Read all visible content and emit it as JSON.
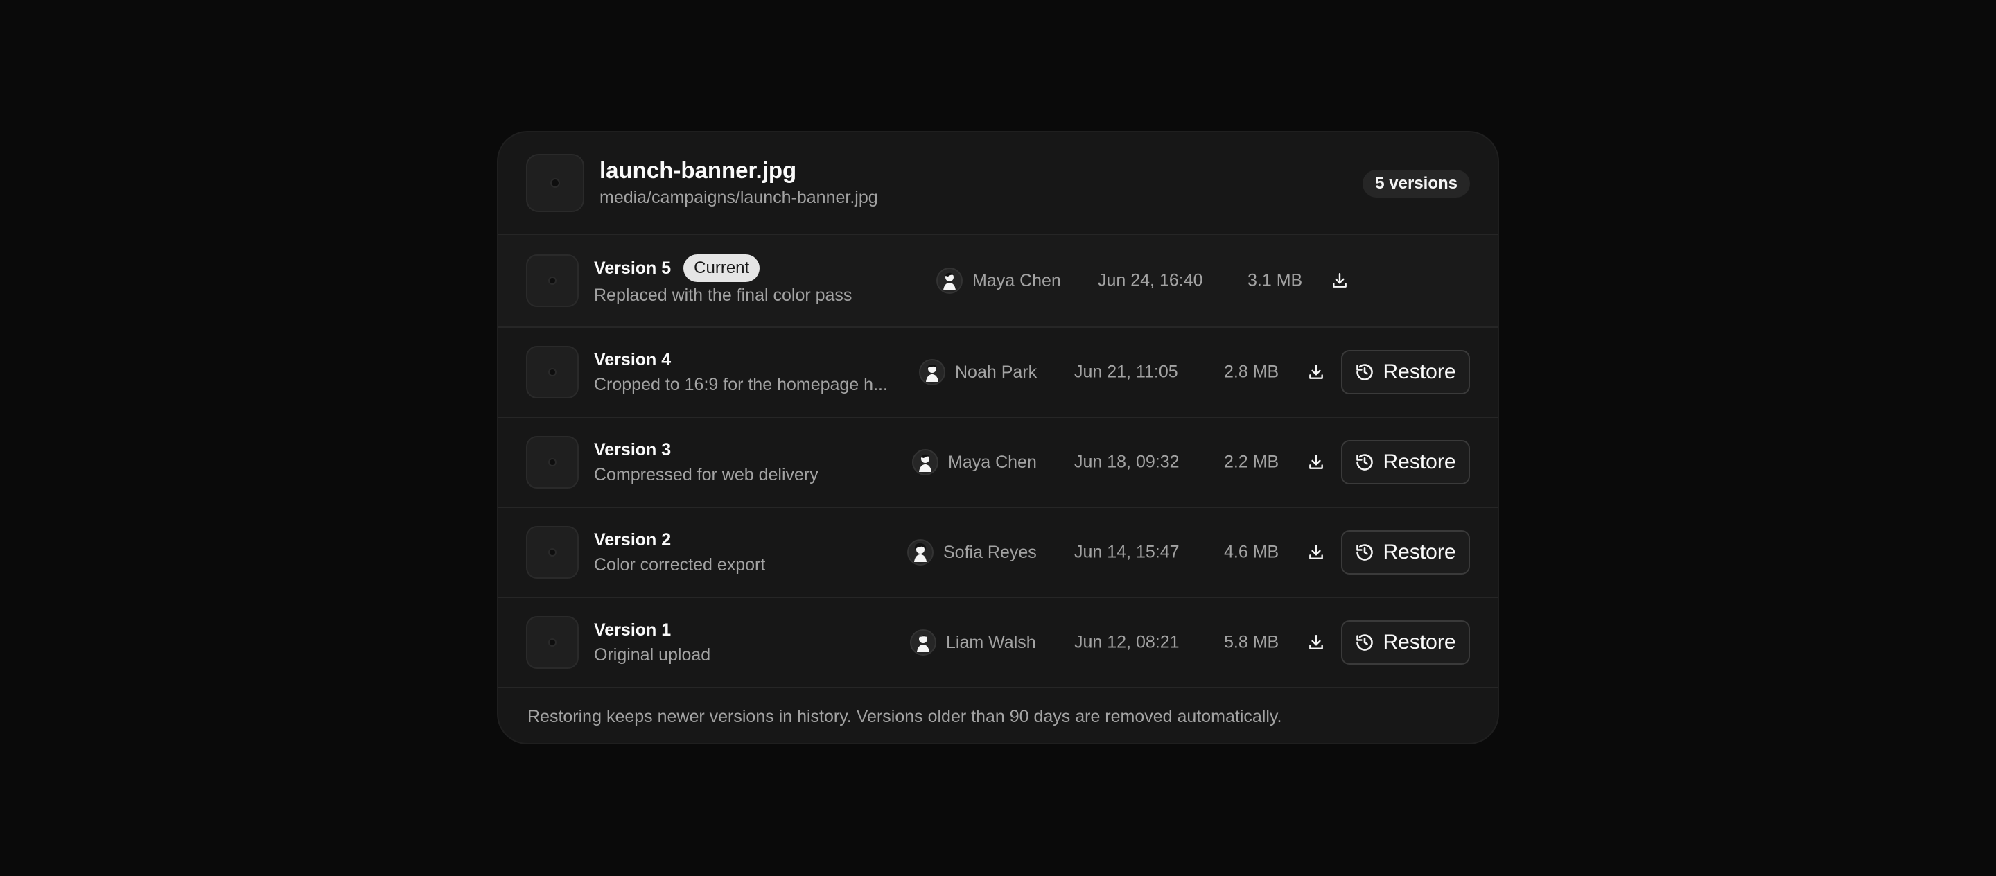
{
  "file": {
    "name": "launch-banner.jpg",
    "path": "media/campaigns/launch-banner.jpg",
    "versions_badge": "5 versions"
  },
  "versions": [
    {
      "title": "Version 5",
      "badge": "Current",
      "description": "Replaced with the final color pass",
      "author": "Maya Chen",
      "date": "Jun 24, 16:40",
      "size": "3.1 MB"
    },
    {
      "title": "Version 4",
      "description": "Cropped to 16:9 for the homepage h...",
      "author": "Noah Park",
      "date": "Jun 21, 11:05",
      "size": "2.8 MB",
      "action": "Restore"
    },
    {
      "title": "Version 3",
      "description": "Compressed for web delivery",
      "author": "Maya Chen",
      "date": "Jun 18, 09:32",
      "size": "2.2 MB",
      "action": "Restore"
    },
    {
      "title": "Version 2",
      "description": "Color corrected export",
      "author": "Sofia Reyes",
      "date": "Jun 14, 15:47",
      "size": "4.6 MB",
      "action": "Restore"
    },
    {
      "title": "Version 1",
      "description": "Original upload",
      "author": "Liam Walsh",
      "date": "Jun 12, 08:21",
      "size": "5.8 MB",
      "action": "Restore"
    }
  ],
  "footer": {
    "note": "Restoring keeps newer versions in history. Versions older than 90 days are removed automatically."
  },
  "icons": {
    "download": "download-icon",
    "restore": "history-icon",
    "thumbnail": "image-placeholder-icon",
    "avatar": "person-avatar-icon"
  }
}
